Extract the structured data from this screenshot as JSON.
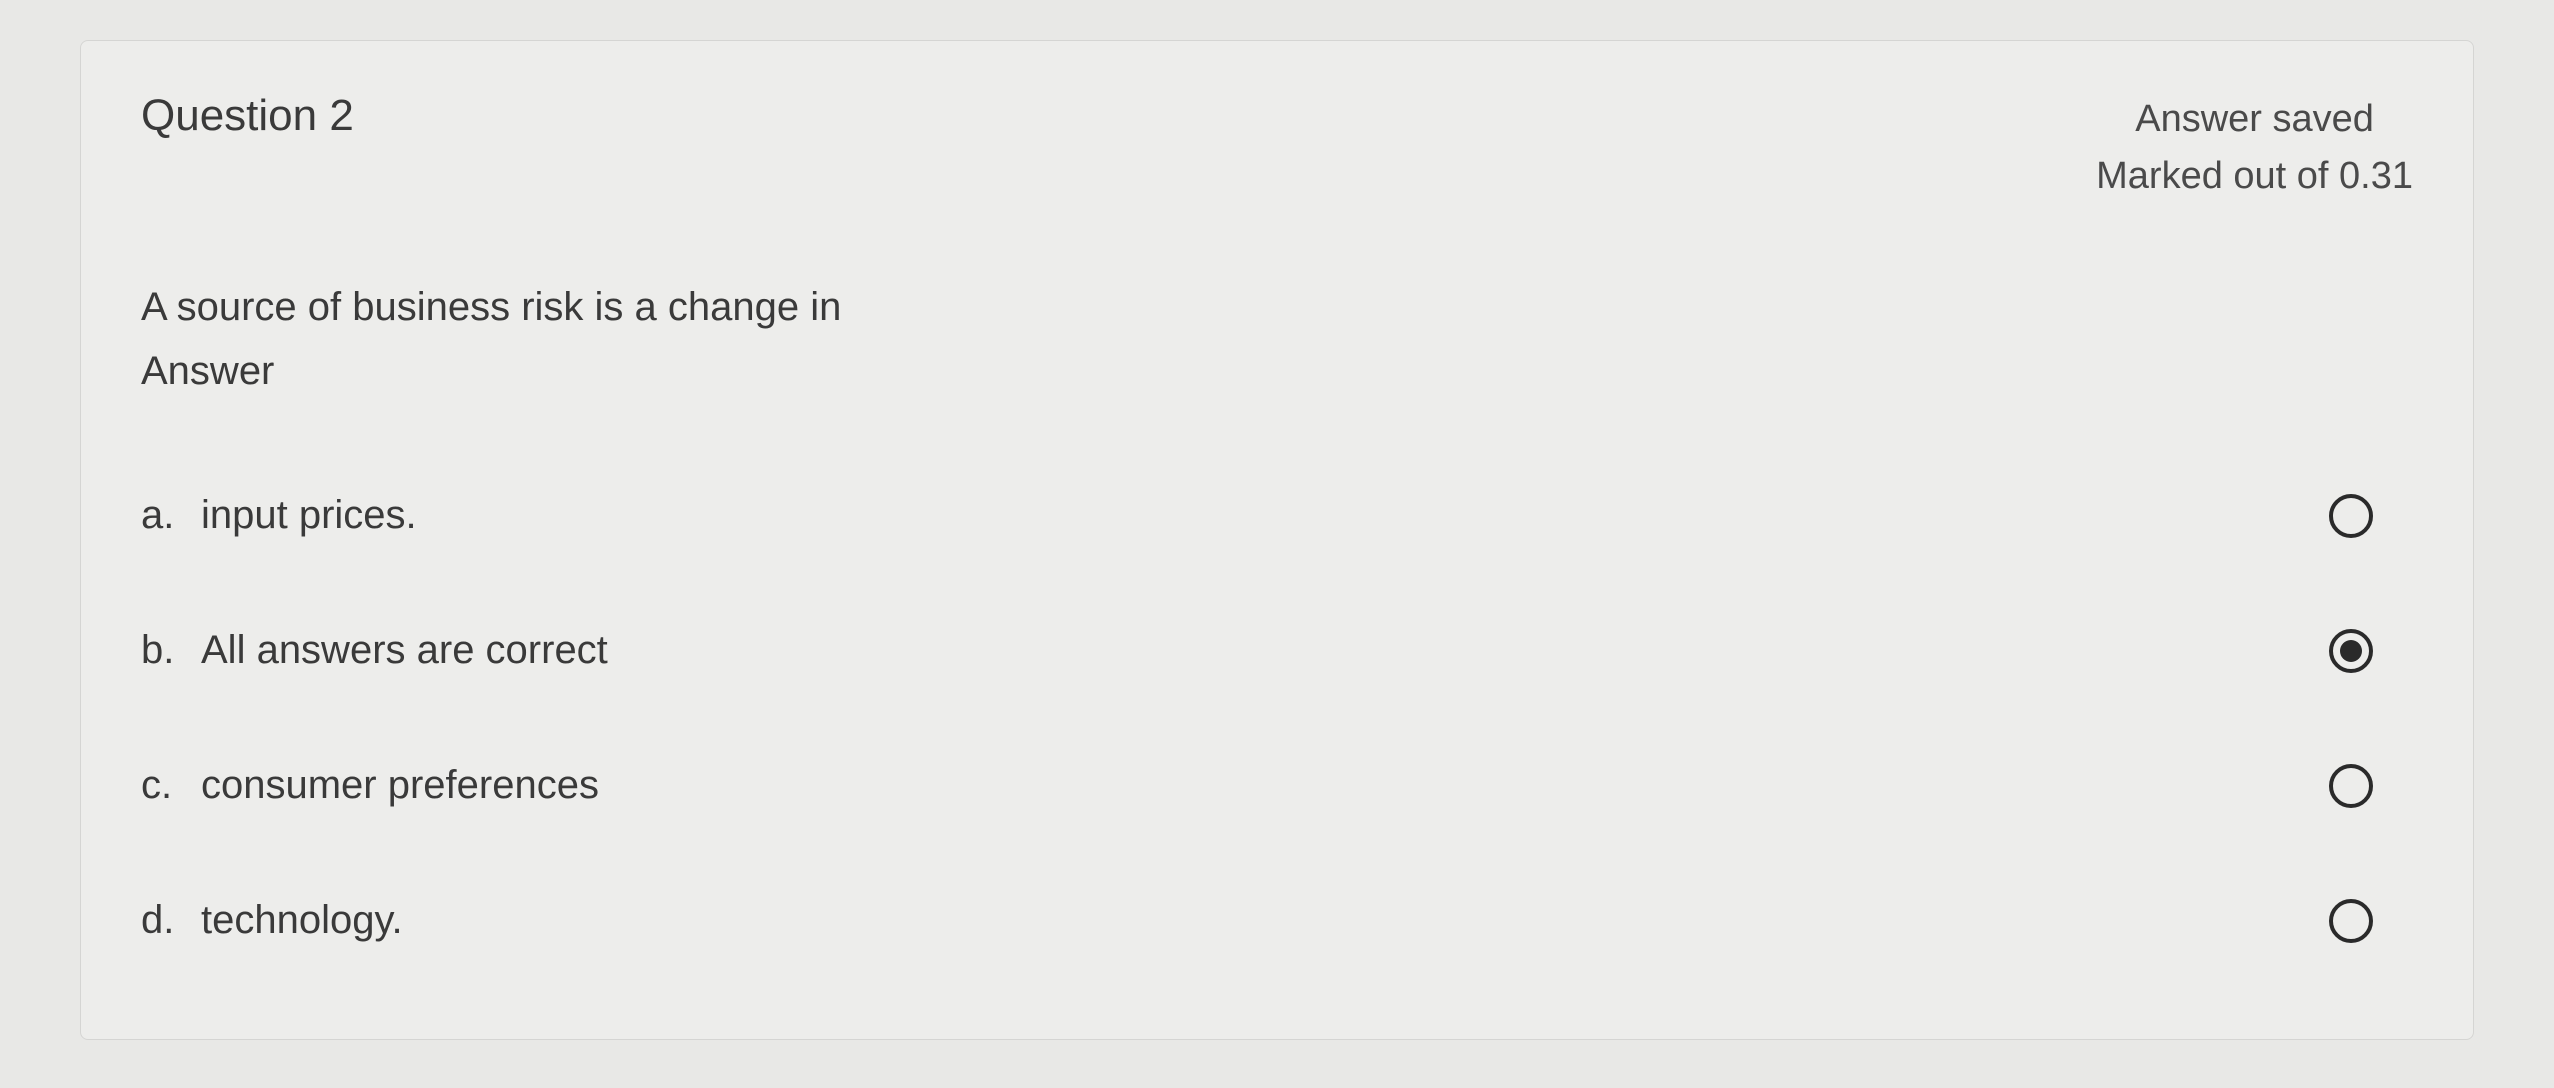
{
  "question": {
    "title": "Question 2",
    "status_saved": "Answer saved",
    "status_marked": "Marked out of 0.31",
    "text_line1": "A source of business risk is a change in",
    "text_line2": "Answer",
    "options": [
      {
        "letter": "a.",
        "label": "input prices.",
        "selected": false
      },
      {
        "letter": "b.",
        "label": "All answers are correct",
        "selected": true
      },
      {
        "letter": "c.",
        "label": "consumer preferences",
        "selected": false
      },
      {
        "letter": "d.",
        "label": "technology.",
        "selected": false
      }
    ]
  }
}
